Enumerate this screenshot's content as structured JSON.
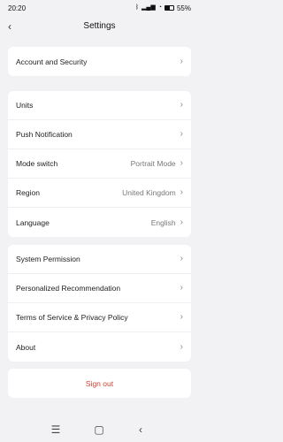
{
  "status": {
    "time": "20:20",
    "battery_percent": 55,
    "battery_label": "55%"
  },
  "header": {
    "title": "Settings",
    "back_icon": "chevron-left-icon"
  },
  "groups": [
    {
      "items": [
        {
          "label": "Account and Security",
          "value": ""
        }
      ]
    },
    {
      "items": [
        {
          "label": "Units",
          "value": ""
        },
        {
          "label": "Push Notification",
          "value": ""
        },
        {
          "label": "Mode switch",
          "value": "Portrait Mode"
        },
        {
          "label": "Region",
          "value": "United Kingdom"
        },
        {
          "label": "Language",
          "value": "English"
        }
      ]
    },
    {
      "items": [
        {
          "label": "System Permission",
          "value": ""
        },
        {
          "label": "Personalized Recommendation",
          "value": ""
        },
        {
          "label": "Terms of Service & Privacy Policy",
          "value": ""
        },
        {
          "label": "About",
          "value": ""
        }
      ]
    }
  ],
  "signout_label": "Sign out",
  "colors": {
    "background": "#f2f2f4",
    "card": "#ffffff",
    "danger": "#d1432f"
  }
}
